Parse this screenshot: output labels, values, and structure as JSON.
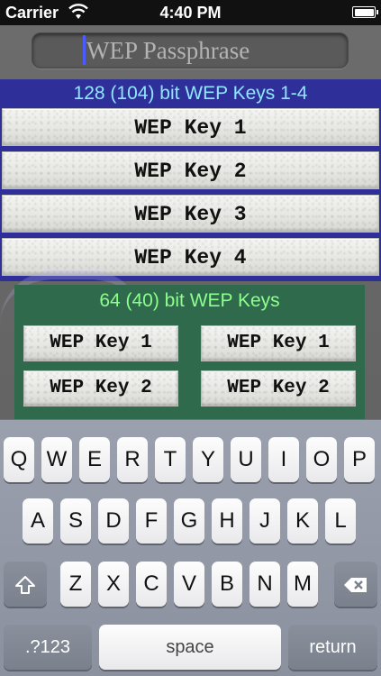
{
  "status_bar": {
    "carrier": "Carrier",
    "time": "4:40 PM"
  },
  "passphrase": {
    "placeholder": "WEP Passphrase",
    "value": ""
  },
  "panel_128": {
    "title": "128 (104) bit WEP Keys 1-4",
    "keys": [
      "WEP Key 1",
      "WEP Key 2",
      "WEP Key 3",
      "WEP Key 4"
    ]
  },
  "panel_64": {
    "title": "64 (40) bit WEP Keys",
    "left_keys": [
      "WEP Key 1",
      "WEP Key 2"
    ],
    "right_keys": [
      "WEP Key 1",
      "WEP Key 2"
    ]
  },
  "keyboard": {
    "row1": [
      "Q",
      "W",
      "E",
      "R",
      "T",
      "Y",
      "U",
      "I",
      "O",
      "P"
    ],
    "row2": [
      "A",
      "S",
      "D",
      "F",
      "G",
      "H",
      "J",
      "K",
      "L"
    ],
    "row3": [
      "Z",
      "X",
      "C",
      "V",
      "B",
      "N",
      "M"
    ],
    "numbers_label": ".?123",
    "space_label": "space",
    "return_label": "return",
    "shift_icon": "shift-arrow-icon",
    "delete_icon": "backspace-icon"
  },
  "colors": {
    "panel_128_bg": "#2f2f9a",
    "panel_128_title": "#8fe6ff",
    "panel_64_bg": "#2f6a4c",
    "panel_64_title": "#8cff8c",
    "caret": "#4a5cff"
  }
}
